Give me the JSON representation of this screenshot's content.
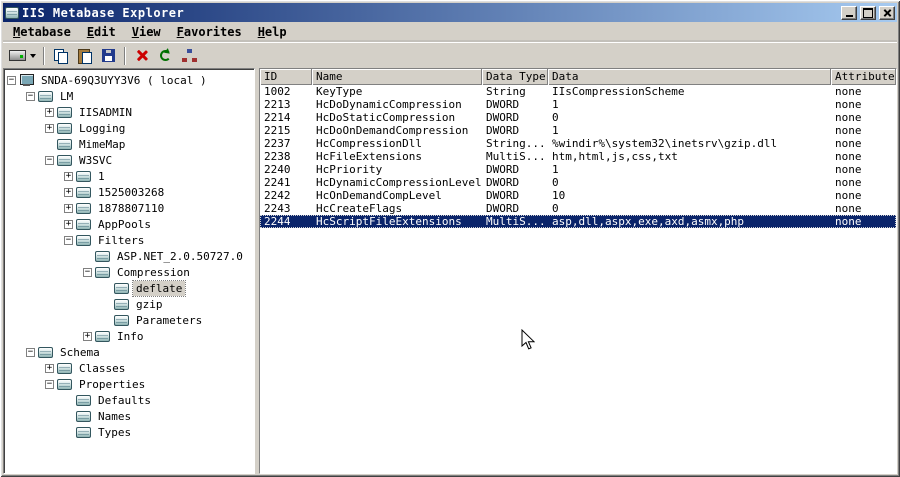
{
  "window": {
    "title": "IIS Metabase Explorer"
  },
  "menu": {
    "items": [
      {
        "label": "Metabase"
      },
      {
        "label": "Edit"
      },
      {
        "label": "View"
      },
      {
        "label": "Favorites"
      },
      {
        "label": "Help"
      }
    ]
  },
  "toolbar": {
    "buttons": [
      {
        "name": "connect",
        "icon": "drive-connect-icon",
        "dropdown": true
      },
      {
        "name": "copy",
        "icon": "copy-icon"
      },
      {
        "name": "paste",
        "icon": "paste-icon"
      },
      {
        "name": "save",
        "icon": "save-icon"
      },
      {
        "name": "delete",
        "icon": "delete-red-x-icon"
      },
      {
        "name": "refresh",
        "icon": "refresh-green-icon"
      },
      {
        "name": "connections",
        "icon": "network-nodes-icon"
      }
    ]
  },
  "tree": {
    "items": [
      {
        "label": "SNDA-69Q3UYY3V6 ( local )",
        "level": 0,
        "box": "minus",
        "icon": "computer",
        "selected": false
      },
      {
        "label": "LM",
        "level": 1,
        "box": "minus",
        "icon": "db",
        "selected": false
      },
      {
        "label": "IISADMIN",
        "level": 2,
        "box": "plus",
        "icon": "db",
        "selected": false
      },
      {
        "label": "Logging",
        "level": 2,
        "box": "plus",
        "icon": "db",
        "selected": false
      },
      {
        "label": "MimeMap",
        "level": 2,
        "box": "none",
        "icon": "db",
        "selected": false
      },
      {
        "label": "W3SVC",
        "level": 2,
        "box": "minus",
        "icon": "db",
        "selected": false
      },
      {
        "label": "1",
        "level": 3,
        "box": "plus",
        "icon": "db",
        "selected": false
      },
      {
        "label": "1525003268",
        "level": 3,
        "box": "plus",
        "icon": "db",
        "selected": false
      },
      {
        "label": "1878807110",
        "level": 3,
        "box": "plus",
        "icon": "db",
        "selected": false
      },
      {
        "label": "AppPools",
        "level": 3,
        "box": "plus",
        "icon": "db",
        "selected": false
      },
      {
        "label": "Filters",
        "level": 3,
        "box": "minus",
        "icon": "db",
        "selected": false
      },
      {
        "label": "ASP.NET_2.0.50727.0",
        "level": 4,
        "box": "none",
        "icon": "db",
        "selected": false
      },
      {
        "label": "Compression",
        "level": 4,
        "box": "minus",
        "icon": "db",
        "selected": false
      },
      {
        "label": "deflate",
        "level": 5,
        "box": "none",
        "icon": "db",
        "selected": true
      },
      {
        "label": "gzip",
        "level": 5,
        "box": "none",
        "icon": "db",
        "selected": false
      },
      {
        "label": "Parameters",
        "level": 5,
        "box": "none",
        "icon": "db",
        "selected": false
      },
      {
        "label": "Info",
        "level": 4,
        "box": "plus",
        "icon": "db",
        "selected": false
      },
      {
        "label": "Schema",
        "level": 1,
        "box": "minus",
        "icon": "db",
        "selected": false
      },
      {
        "label": "Classes",
        "level": 2,
        "box": "plus",
        "icon": "db",
        "selected": false
      },
      {
        "label": "Properties",
        "level": 2,
        "box": "minus",
        "icon": "db",
        "selected": false
      },
      {
        "label": "Defaults",
        "level": 3,
        "box": "none",
        "icon": "db",
        "selected": false
      },
      {
        "label": "Names",
        "level": 3,
        "box": "none",
        "icon": "db",
        "selected": false
      },
      {
        "label": "Types",
        "level": 3,
        "box": "none",
        "icon": "db",
        "selected": false
      }
    ]
  },
  "table": {
    "columns": [
      "ID",
      "Name",
      "Data Type",
      "Data",
      "Attributes"
    ],
    "rows": [
      {
        "cells": [
          "1002",
          "KeyType",
          "String",
          "IIsCompressionScheme",
          "none"
        ],
        "selected": false
      },
      {
        "cells": [
          "2213",
          "HcDoDynamicCompression",
          "DWORD",
          "1",
          "none"
        ],
        "selected": false
      },
      {
        "cells": [
          "2214",
          "HcDoStaticCompression",
          "DWORD",
          "0",
          "none"
        ],
        "selected": false
      },
      {
        "cells": [
          "2215",
          "HcDoOnDemandCompression",
          "DWORD",
          "1",
          "none"
        ],
        "selected": false
      },
      {
        "cells": [
          "2237",
          "HcCompressionDll",
          "String...",
          "%windir%\\system32\\inetsrv\\gzip.dll",
          "none"
        ],
        "selected": false
      },
      {
        "cells": [
          "2238",
          "HcFileExtensions",
          "MultiS...",
          "htm,html,js,css,txt",
          "none"
        ],
        "selected": false
      },
      {
        "cells": [
          "2240",
          "HcPriority",
          "DWORD",
          "1",
          "none"
        ],
        "selected": false
      },
      {
        "cells": [
          "2241",
          "HcDynamicCompressionLevel",
          "DWORD",
          "0",
          "none"
        ],
        "selected": false
      },
      {
        "cells": [
          "2242",
          "HcOnDemandCompLevel",
          "DWORD",
          "10",
          "none"
        ],
        "selected": false
      },
      {
        "cells": [
          "2243",
          "HcCreateFlags",
          "DWORD",
          "0",
          "none"
        ],
        "selected": false
      },
      {
        "cells": [
          "2244",
          "HcScriptFileExtensions",
          "MultiS...",
          "asp,dll,aspx,exe,axd,asmx,php",
          "none"
        ],
        "selected": true
      }
    ]
  },
  "colors": {
    "window_bg": "#d4d0c8",
    "titlebar_start": "#0a246a",
    "titlebar_end": "#a6caf0",
    "selection": "#0a246a",
    "selection_text": "#ffffff",
    "pane_bg": "#ffffff",
    "inactive_selection": "#d4d0c8"
  }
}
